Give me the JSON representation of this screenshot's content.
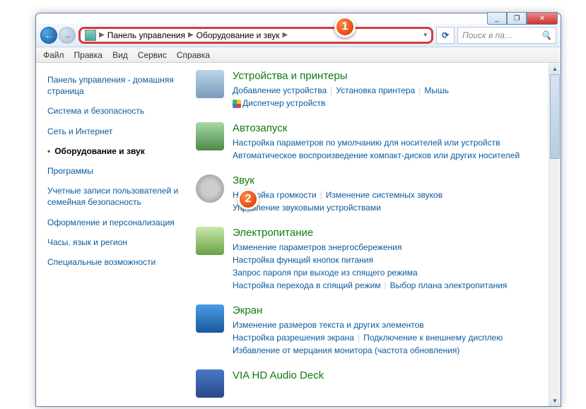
{
  "titlebar": {
    "min": "_",
    "max": "❐",
    "close": "✕"
  },
  "address": {
    "root": "Панель управления",
    "sub": "Оборудование и звук",
    "sep": "▶"
  },
  "refresh": "⟳",
  "search": {
    "placeholder": "Поиск в па…",
    "icon": "🔍"
  },
  "menu": [
    "Файл",
    "Правка",
    "Вид",
    "Сервис",
    "Справка"
  ],
  "sidebar": [
    {
      "label": "Панель управления -\nдомашняя страница",
      "active": false,
      "head": true
    },
    {
      "label": "Система и безопасность",
      "active": false
    },
    {
      "label": "Сеть и Интернет",
      "active": false
    },
    {
      "label": "Оборудование и звук",
      "active": true
    },
    {
      "label": "Программы",
      "active": false
    },
    {
      "label": "Учетные записи пользователей и семейная безопасность",
      "active": false
    },
    {
      "label": "Оформление и персонализация",
      "active": false
    },
    {
      "label": "Часы, язык и регион",
      "active": false
    },
    {
      "label": "Специальные возможности",
      "active": false
    }
  ],
  "categories": [
    {
      "icon": "ic-dev",
      "title": "Устройства и принтеры",
      "links": [
        [
          "Добавление устройства",
          "Установка принтера",
          "Мышь"
        ],
        [
          "@shield@Диспетчер устройств"
        ]
      ]
    },
    {
      "icon": "ic-auto",
      "title": "Автозапуск",
      "links": [
        [
          "Настройка параметров по умолчанию для носителей или устройств"
        ],
        [
          "Автоматическое воспроизведение компакт-дисков или других носителей"
        ]
      ]
    },
    {
      "icon": "ic-snd",
      "title": "Звук",
      "links": [
        [
          "Настройка громкости",
          "Изменение системных звуков"
        ],
        [
          "Управление звуковыми устройствами"
        ]
      ]
    },
    {
      "icon": "ic-pwr",
      "title": "Электропитание",
      "links": [
        [
          "Изменение параметров энергосбережения"
        ],
        [
          "Настройка функций кнопок питания"
        ],
        [
          "Запрос пароля при выходе из спящего режима"
        ],
        [
          "Настройка перехода в спящий режим",
          "Выбор плана электропитания"
        ]
      ]
    },
    {
      "icon": "ic-scr",
      "title": "Экран",
      "links": [
        [
          "Изменение размеров текста и других элементов"
        ],
        [
          "Настройка разрешения экрана",
          "Подключение к внешнему дисплею"
        ],
        [
          "Избавление от мерцания монитора (частота обновления)"
        ]
      ]
    },
    {
      "icon": "ic-via",
      "title": "VIA HD Audio Deck",
      "links": []
    }
  ],
  "callouts": {
    "1": "1",
    "2": "2"
  }
}
